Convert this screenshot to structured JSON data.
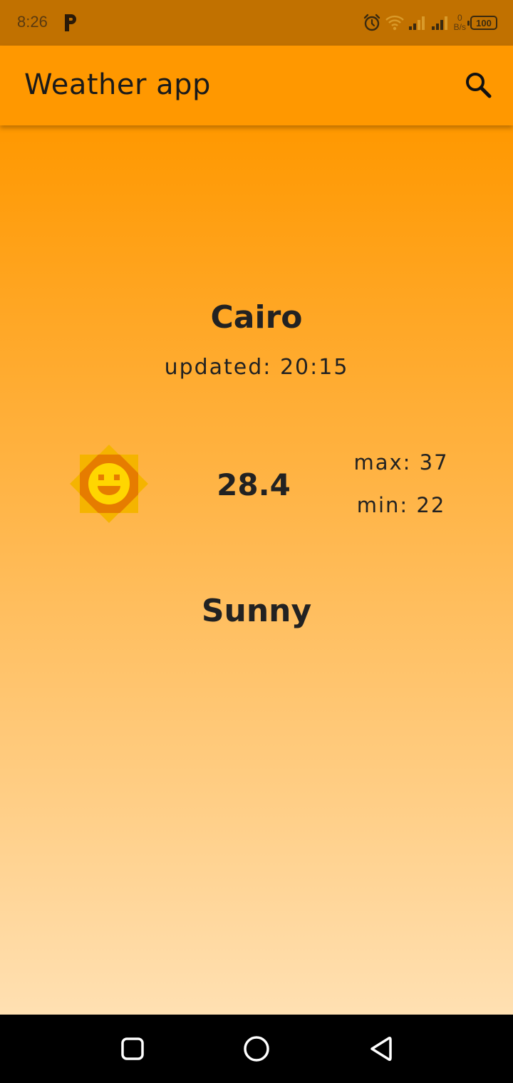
{
  "status_bar": {
    "time": "8:26",
    "app_indicator_icon": "p-app-icon",
    "alarm_icon": "alarm-icon",
    "wifi_icon": "wifi-icon",
    "signal_icons": [
      "signal-sim1-icon",
      "signal-sim2-icon"
    ],
    "net_speed_value": "0",
    "net_speed_unit": "B/s",
    "battery_level": "100"
  },
  "app_bar": {
    "title": "Weather app",
    "search_icon": "search-icon"
  },
  "weather": {
    "city": "Cairo",
    "updated": "updated: 20:15",
    "icon": "sun-icon",
    "temperature": "28.4",
    "max": "max: 37",
    "min": "min: 22",
    "condition": "Sunny"
  },
  "nav_bar": {
    "recents_icon": "recents-square-icon",
    "home_icon": "home-circle-icon",
    "back_icon": "back-triangle-icon"
  },
  "colors": {
    "status_bar": "#c17100",
    "app_bar": "#ff9800",
    "gradient_top": "#ff9800",
    "gradient_bottom": "#ffe0b2",
    "sun_outer": "#f5b400",
    "sun_ring": "#e67c00",
    "sun_face": "#ffd600",
    "nav_bar": "#000000"
  }
}
